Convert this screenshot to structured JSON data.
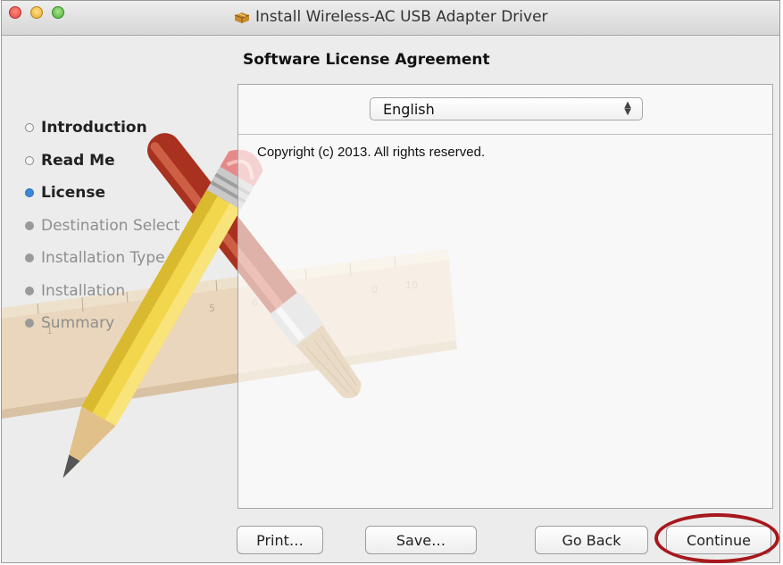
{
  "window": {
    "title": "Install Wireless-AC USB Adapter Driver",
    "title_icon": "package-icon"
  },
  "page": {
    "heading": "Software License Agreement"
  },
  "sidebar": {
    "steps": [
      {
        "label": "Introduction",
        "state": "done"
      },
      {
        "label": "Read Me",
        "state": "done"
      },
      {
        "label": "License",
        "state": "current"
      },
      {
        "label": "Destination Select",
        "state": "future"
      },
      {
        "label": "Installation Type",
        "state": "future"
      },
      {
        "label": "Installation",
        "state": "future"
      },
      {
        "label": "Summary",
        "state": "future"
      }
    ]
  },
  "language": {
    "selected": "English"
  },
  "license_text": "Copyright (c) 2013.  All rights reserved.",
  "buttons": {
    "print": "Print…",
    "save": "Save…",
    "go_back": "Go Back",
    "continue": "Continue"
  },
  "colors": {
    "highlight": "#a6181d",
    "current_step": "#3b87d8"
  }
}
